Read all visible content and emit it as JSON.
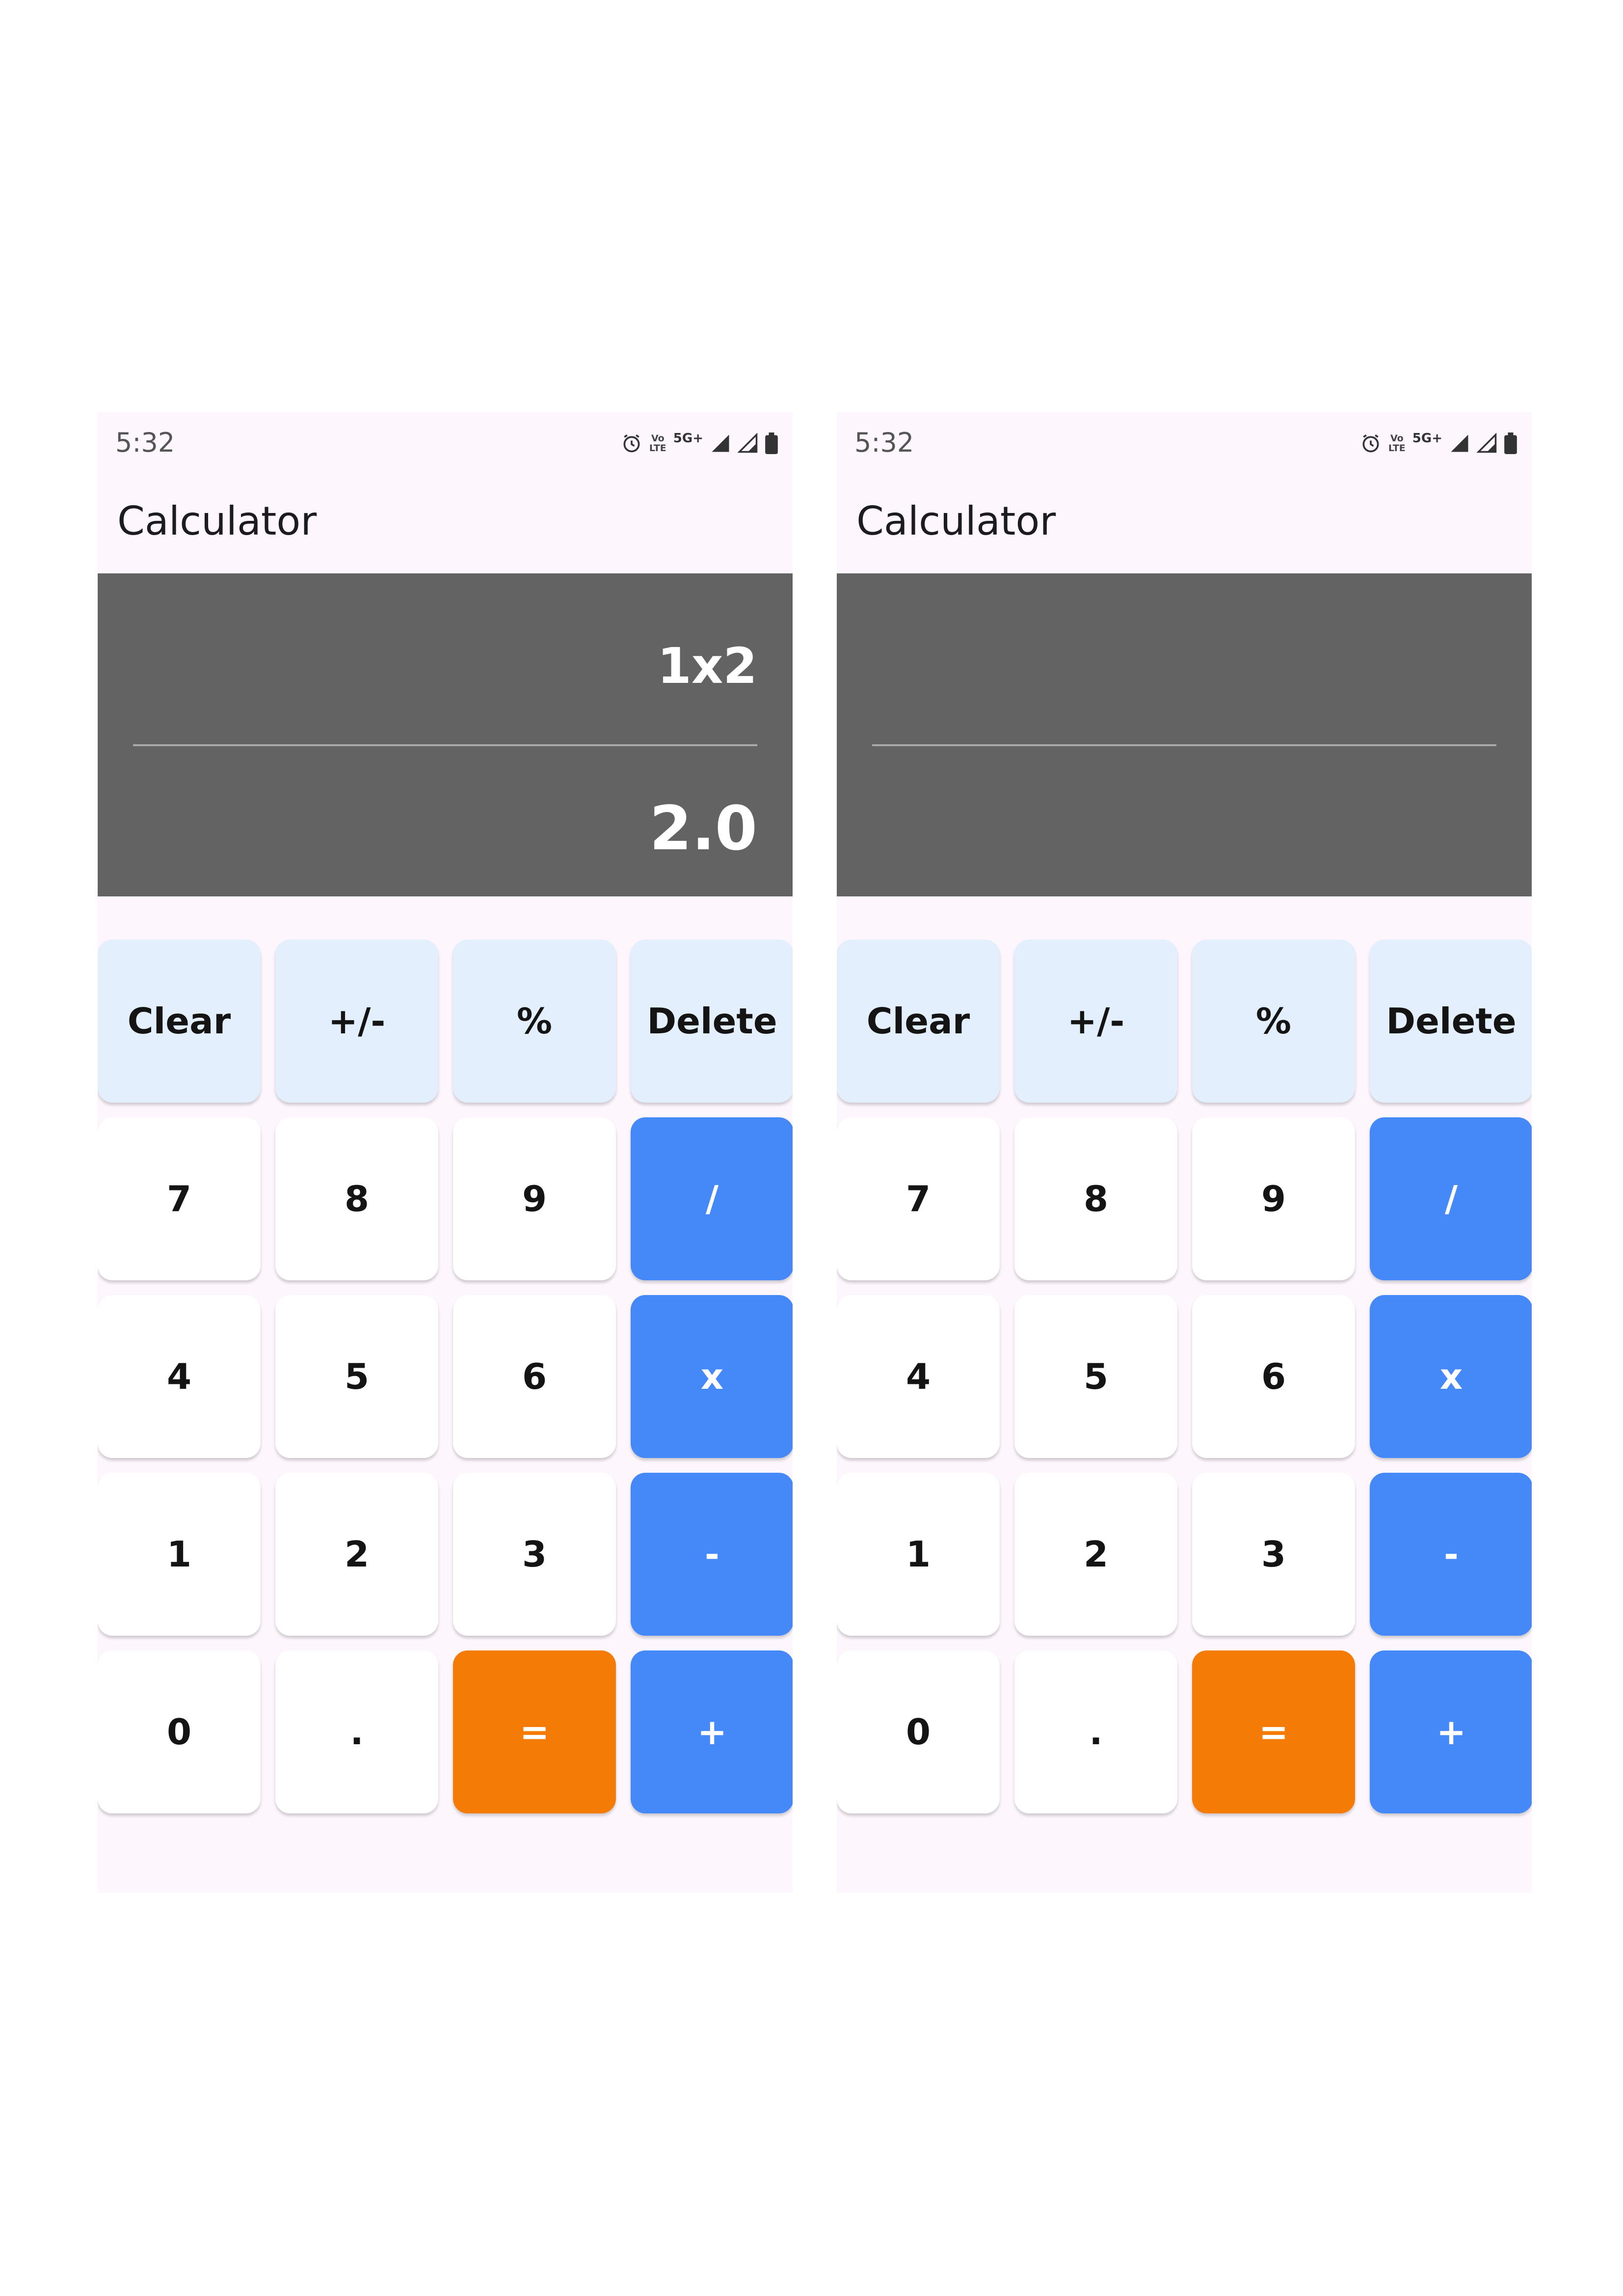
{
  "screens": [
    {
      "status": {
        "time": "5:32",
        "volte_top": "Vo",
        "volte_bottom": "LTE",
        "network": "5G+"
      },
      "title": "Calculator",
      "expression": "1x2",
      "result": "2.0",
      "keys": [
        "Clear",
        "+/-",
        "%",
        "Delete",
        "7",
        "8",
        "9",
        "/",
        "4",
        "5",
        "6",
        "x",
        "1",
        "2",
        "3",
        "-",
        "0",
        ".",
        "=",
        "+"
      ]
    },
    {
      "status": {
        "time": "5:32",
        "volte_top": "Vo",
        "volte_bottom": "LTE",
        "network": "5G+"
      },
      "title": "Calculator",
      "expression": "",
      "result": "",
      "keys": [
        "Clear",
        "+/-",
        "%",
        "Delete",
        "7",
        "8",
        "9",
        "/",
        "4",
        "5",
        "6",
        "x",
        "1",
        "2",
        "3",
        "-",
        "0",
        ".",
        "=",
        "+"
      ]
    }
  ],
  "colors": {
    "phone_bg": "#fdf7fd",
    "display_bg": "#636363",
    "function_key": "#e3effc",
    "operator_key": "#4589f8",
    "equals_key": "#f47b06",
    "digit_key": "#ffffff"
  }
}
